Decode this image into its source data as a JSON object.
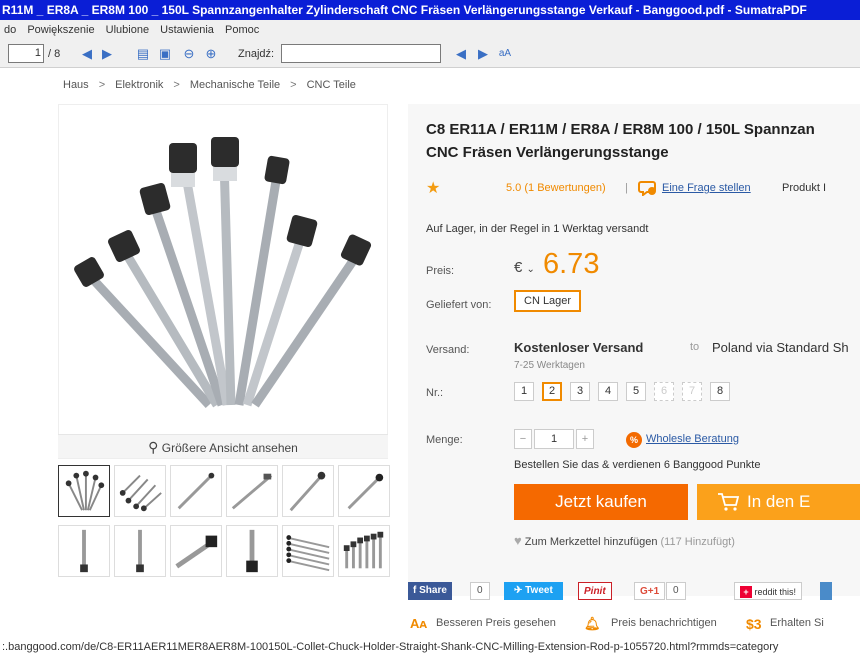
{
  "window": {
    "title": "R11M _ ER8A _ ER8M 100 _ 150L Spannzangenhalter Zylinderschaft CNC Fräsen Verlängerungsstange Verkauf - Banggood.pdf - SumatraPDF"
  },
  "menu": {
    "items": [
      "do",
      "Powiększenie",
      "Ulubione",
      "Ustawienia",
      "Pomoc"
    ]
  },
  "toolbar": {
    "page_value": "1",
    "page_total": "/ 8",
    "find_label": "Znajdź:"
  },
  "breadcrumb": [
    "Haus",
    "Elektronik",
    "Mechanische Teile",
    "CNC Teile"
  ],
  "gallery": {
    "zoom_label": "Größere Ansicht ansehen"
  },
  "product": {
    "title_line1": "C8 ER11A / ER11M / ER8A / ER8M 100 / 150L Spannzan",
    "title_line2": "CNC Fräsen Verlängerungsstange",
    "rating": "5.0",
    "reviews": "(1 Bewertungen)",
    "ask_question": "Eine Frage stellen",
    "produkt_label": "Produkt I",
    "stock": "Auf Lager, in der Regel in 1 Werktag versandt",
    "price_label": "Preis:",
    "currency": "€",
    "price": "6.73",
    "delivered_label": "Geliefert von:",
    "warehouse": "CN Lager",
    "shipping_label": "Versand:",
    "shipping_method": "Kostenloser Versand",
    "shipping_to": "to",
    "shipping_dest": "Poland via Standard Sh",
    "shipping_time": "7-25 Werktagen",
    "nr_label": "Nr.:",
    "options": [
      "1",
      "2",
      "3",
      "4",
      "5",
      "6",
      "7",
      "8"
    ],
    "selected_option": "2",
    "disabled_options": [
      "6",
      "7"
    ],
    "qty_label": "Menge:",
    "qty_minus": "−",
    "qty_value": "1",
    "qty_plus": "+",
    "wholesale": "Wholesle Beratung",
    "points": "Bestellen Sie das & verdienen 6 Banggood Punkte",
    "buy_now": "Jetzt kaufen",
    "add_cart": "In den E",
    "wishlist": "Zum Merkzettel hinzufügen",
    "wishlist_count": "(117 Hinzufügt)"
  },
  "share": {
    "facebook": "Share",
    "facebook_count": "0",
    "twitter": "Tweet",
    "pinterest": "Pinit",
    "google": "G+1",
    "google_count": "0",
    "reddit": "reddit this!"
  },
  "promo": {
    "better_price": "Besseren Preis gesehen",
    "notify": "Preis benachrichtigen",
    "earn": "Erhalten Si",
    "earn_icon": "$3"
  },
  "status": {
    "url": ":.banggood.com/de/C8-ER11AER11MER8AER8M-100150L-Collet-Chuck-Holder-Straight-Shank-CNC-Milling-Extension-Rod-p-1055720.html?rmmds=category"
  },
  "colors": {
    "accent": "#f08a00",
    "buy": "#f56900",
    "cart": "#fba11b",
    "titlebar": "#0a1ed6"
  }
}
